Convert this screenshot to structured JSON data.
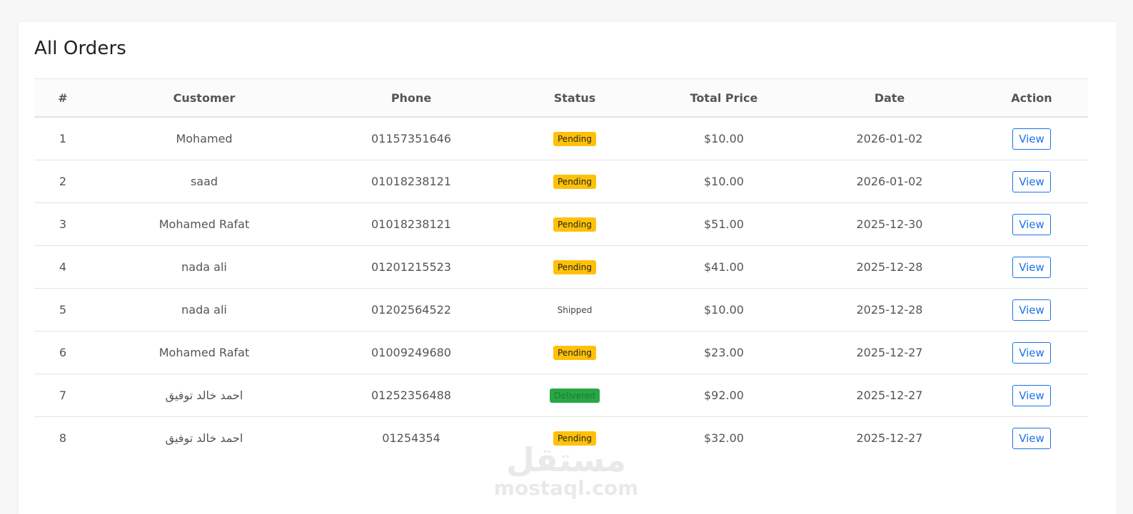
{
  "page": {
    "title": "All Orders"
  },
  "table": {
    "headers": [
      "#",
      "Customer",
      "Phone",
      "Status",
      "Total Price",
      "Date",
      "Action"
    ],
    "rows": [
      {
        "num": "1",
        "customer": "Mohamed",
        "phone": "01157351646",
        "status": "Pending",
        "price": "$10.00",
        "date": "2026-01-02",
        "action": "View"
      },
      {
        "num": "2",
        "customer": "saad",
        "phone": "01018238121",
        "status": "Pending",
        "price": "$10.00",
        "date": "2026-01-02",
        "action": "View"
      },
      {
        "num": "3",
        "customer": "Mohamed Rafat",
        "phone": "01018238121",
        "status": "Pending",
        "price": "$51.00",
        "date": "2025-12-30",
        "action": "View"
      },
      {
        "num": "4",
        "customer": "nada ali",
        "phone": "01201215523",
        "status": "Pending",
        "price": "$41.00",
        "date": "2025-12-28",
        "action": "View"
      },
      {
        "num": "5",
        "customer": "nada ali",
        "phone": "01202564522",
        "status": "Shipped",
        "price": "$10.00",
        "date": "2025-12-28",
        "action": "View"
      },
      {
        "num": "6",
        "customer": "Mohamed Rafat",
        "phone": "01009249680",
        "status": "Pending",
        "price": "$23.00",
        "date": "2025-12-27",
        "action": "View"
      },
      {
        "num": "7",
        "customer": "احمد خالد توفيق",
        "phone": "01252356488",
        "status": "Delivered",
        "price": "$92.00",
        "date": "2025-12-27",
        "action": "View"
      },
      {
        "num": "8",
        "customer": "احمد خالد توفيق",
        "phone": "01254354",
        "status": "Pending",
        "price": "$32.00",
        "date": "2025-12-27",
        "action": "View"
      }
    ]
  },
  "colors": {
    "pending": "#ffc107",
    "delivered": "#28a745",
    "price": "#28a745",
    "link": "#1a73e8"
  },
  "watermark": {
    "arabic": "مستقل",
    "latin": "mostaql.com"
  }
}
